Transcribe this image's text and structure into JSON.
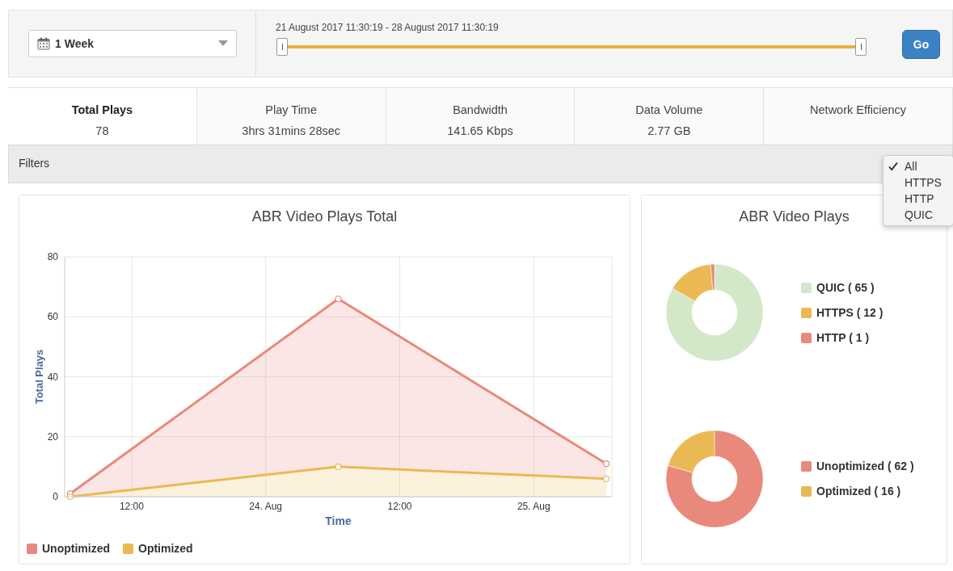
{
  "toolbar": {
    "period": "1 Week",
    "slider": {
      "label": "21 August 2017 11:30:19 - 28 August 2017 11:30:19",
      "level": 1
    },
    "go_button": "Go"
  },
  "stats": [
    {
      "label": "Total Plays",
      "value": "78",
      "selected": true
    },
    {
      "label": "Play Time",
      "value": "3hrs 31mins 28sec",
      "selected": false
    },
    {
      "label": "Bandwidth",
      "value": "141.65 Kbps",
      "selected": false
    },
    {
      "label": "Data Volume",
      "value": "2.77 GB",
      "selected": false
    },
    {
      "label": "Network Efficiency",
      "selected": false
    }
  ],
  "filters": {
    "label": "Filters",
    "menu": [
      {
        "label": "All",
        "selected": true
      },
      {
        "label": "HTTPS",
        "selected": false
      },
      {
        "label": "HTTP",
        "selected": false
      },
      {
        "label": "QUIC",
        "selected": false
      }
    ]
  },
  "line_chart": {
    "chart_data": {
      "type": "area",
      "grid": true,
      "title": "ABR Video Plays Total",
      "xlabel": "Time",
      "ylabel": "Total Plays",
      "stacked": true,
      "x": [
        "2017-08-23T06:30:00Z",
        "2017-08-24T06:30:00Z",
        "2017-08-25T06:30:00Z"
      ],
      "xlim": [
        "2017-08-23T06:00:00Z",
        "2017-08-25T07:00:00Z"
      ],
      "ylim": [
        0,
        80
      ],
      "yticks": [
        0,
        20,
        40,
        60,
        80
      ],
      "xticks": [
        {
          "value": "2017-08-23T12:00:00Z",
          "label": "12:00"
        },
        {
          "value": "2017-08-24T00:00:00Z",
          "label": "24. Aug"
        },
        {
          "value": "2017-08-24T12:00:00Z",
          "label": "12:00"
        },
        {
          "value": "2017-08-25T00:00:00Z",
          "label": "25. Aug"
        }
      ],
      "series": [
        {
          "name": "Unoptimized",
          "color": "#e8897b",
          "values": [
            1,
            56,
            5
          ]
        },
        {
          "name": "Optimized",
          "color": "#ebb954",
          "values": [
            0,
            10,
            6
          ]
        }
      ]
    }
  },
  "donut_card": {
    "title": "ABR Video Plays",
    "donuts": [
      {
        "chart_data": {
          "type": "donut",
          "categories": [
            "QUIC ( 65 )",
            "HTTPS ( 12 )",
            "HTTP ( 1 )"
          ],
          "values": [
            83.33,
            15.39,
            1.28
          ]
        },
        "slices": [
          {
            "color": "#d3e8c8"
          },
          {
            "color": "#ebb954"
          },
          {
            "color": "#e8897b"
          }
        ]
      },
      {
        "chart_data": {
          "type": "donut",
          "categories": [
            "Unoptimized ( 62 )",
            "Optimized ( 16 )"
          ],
          "values": [
            79.49,
            20.51
          ]
        },
        "slices": [
          {
            "color": "#e8897b"
          },
          {
            "color": "#ebb954"
          }
        ]
      }
    ]
  }
}
